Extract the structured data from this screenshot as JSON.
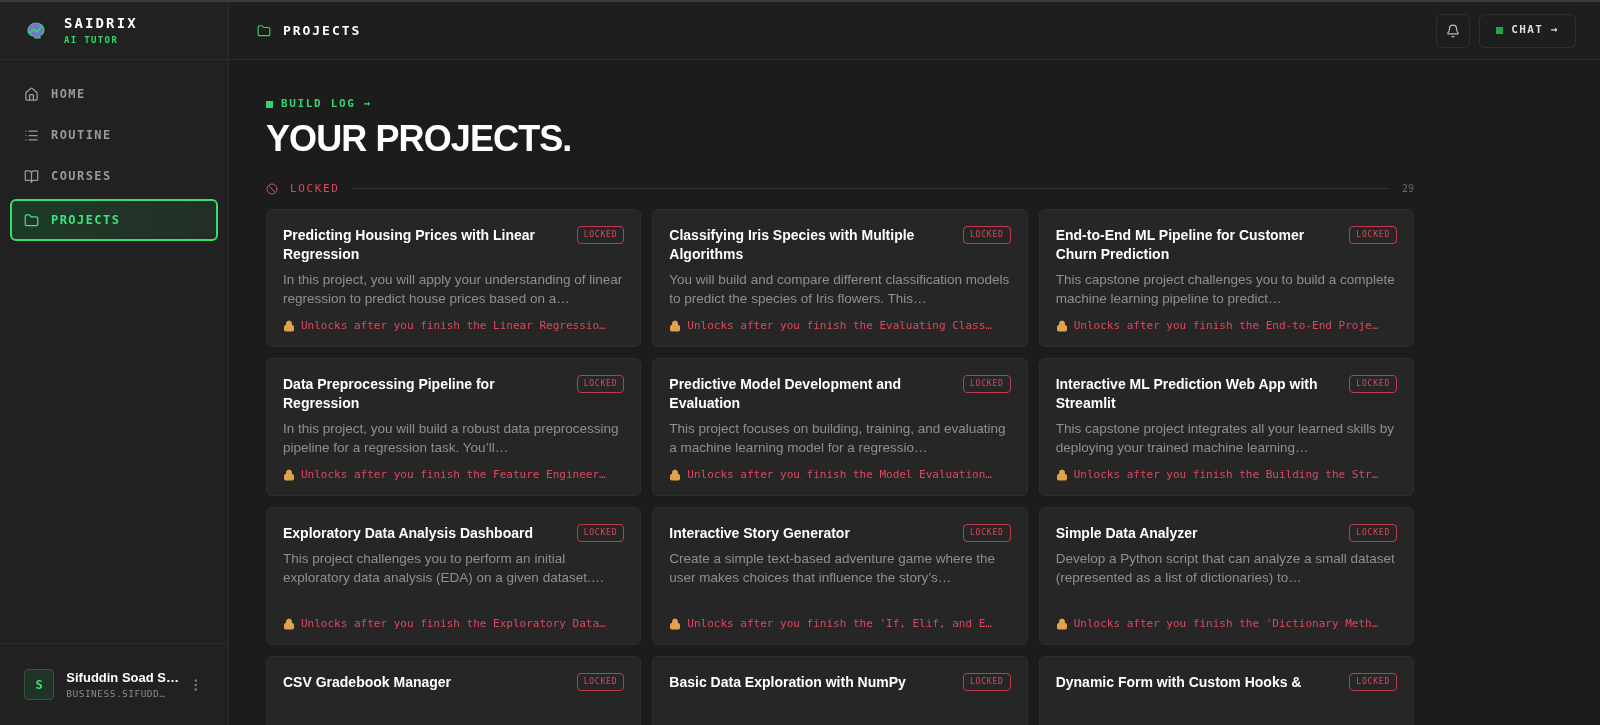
{
  "sidebar": {
    "brand": {
      "name": "SAIDRIX",
      "tagline": "AI TUTOR"
    },
    "nav": [
      {
        "label": "HOME",
        "selected": false
      },
      {
        "label": "ROUTINE",
        "selected": false
      },
      {
        "label": "COURSES",
        "selected": false
      },
      {
        "label": "PROJECTS",
        "selected": true
      }
    ],
    "user": {
      "initial": "S",
      "name": "Sifuddin Soad S…",
      "email": "BUSINESS.SIFUDD…"
    }
  },
  "header": {
    "title": "PROJECTS",
    "chat_button": "CHAT →"
  },
  "page": {
    "eyebrow": "BUILD LOG →",
    "title": "YOUR PROJECTS."
  },
  "section": {
    "label": "LOCKED",
    "count": "29"
  },
  "projects": [
    {
      "title": "Predicting Housing Prices with Linear Regression",
      "badge": "LOCKED",
      "description": "In this project, you will apply your understanding of linear regression to predict house prices based on a…",
      "unlock": "Unlocks after you finish the Linear Regressio…"
    },
    {
      "title": "Classifying Iris Species with Multiple Algorithms",
      "badge": "LOCKED",
      "description": "You will build and compare different classification models to predict the species of Iris flowers. This…",
      "unlock": "Unlocks after you finish the Evaluating Class…"
    },
    {
      "title": "End-to-End ML Pipeline for Customer Churn Prediction",
      "badge": "LOCKED",
      "description": "This capstone project challenges you to build a complete machine learning pipeline to predict…",
      "unlock": "Unlocks after you finish the End-to-End Proje…"
    },
    {
      "title": "Data Preprocessing Pipeline for Regression",
      "badge": "LOCKED",
      "description": "In this project, you will build a robust data preprocessing pipeline for a regression task. You’ll…",
      "unlock": "Unlocks after you finish the Feature Engineer…"
    },
    {
      "title": "Predictive Model Development and Evaluation",
      "badge": "LOCKED",
      "description": "This project focuses on building, training, and evaluating a machine learning model for a regressio…",
      "unlock": "Unlocks after you finish the Model Evaluation…"
    },
    {
      "title": "Interactive ML Prediction Web App with Streamlit",
      "badge": "LOCKED",
      "description": "This capstone project integrates all your learned skills by deploying your trained machine learning…",
      "unlock": "Unlocks after you finish the Building the Str…"
    },
    {
      "title": "Exploratory Data Analysis Dashboard",
      "badge": "LOCKED",
      "description": "This project challenges you to perform an initial exploratory data analysis (EDA) on a given dataset.…",
      "unlock": "Unlocks after you finish the Exploratory Data…"
    },
    {
      "title": "Interactive Story Generator",
      "badge": "LOCKED",
      "description": "Create a simple text-based adventure game where the user makes choices that influence the story’s…",
      "unlock": "Unlocks after you finish the 'If, Elif, and E…"
    },
    {
      "title": "Simple Data Analyzer",
      "badge": "LOCKED",
      "description": "Develop a Python script that can analyze a small dataset (represented as a list of dictionaries) to…",
      "unlock": "Unlocks after you finish the 'Dictionary Meth…"
    },
    {
      "title": "CSV Gradebook Manager",
      "badge": "LOCKED"
    },
    {
      "title": "Basic Data Exploration with NumPy",
      "badge": "LOCKED"
    },
    {
      "title": "Dynamic Form with Custom Hooks &",
      "badge": "LOCKED"
    }
  ]
}
